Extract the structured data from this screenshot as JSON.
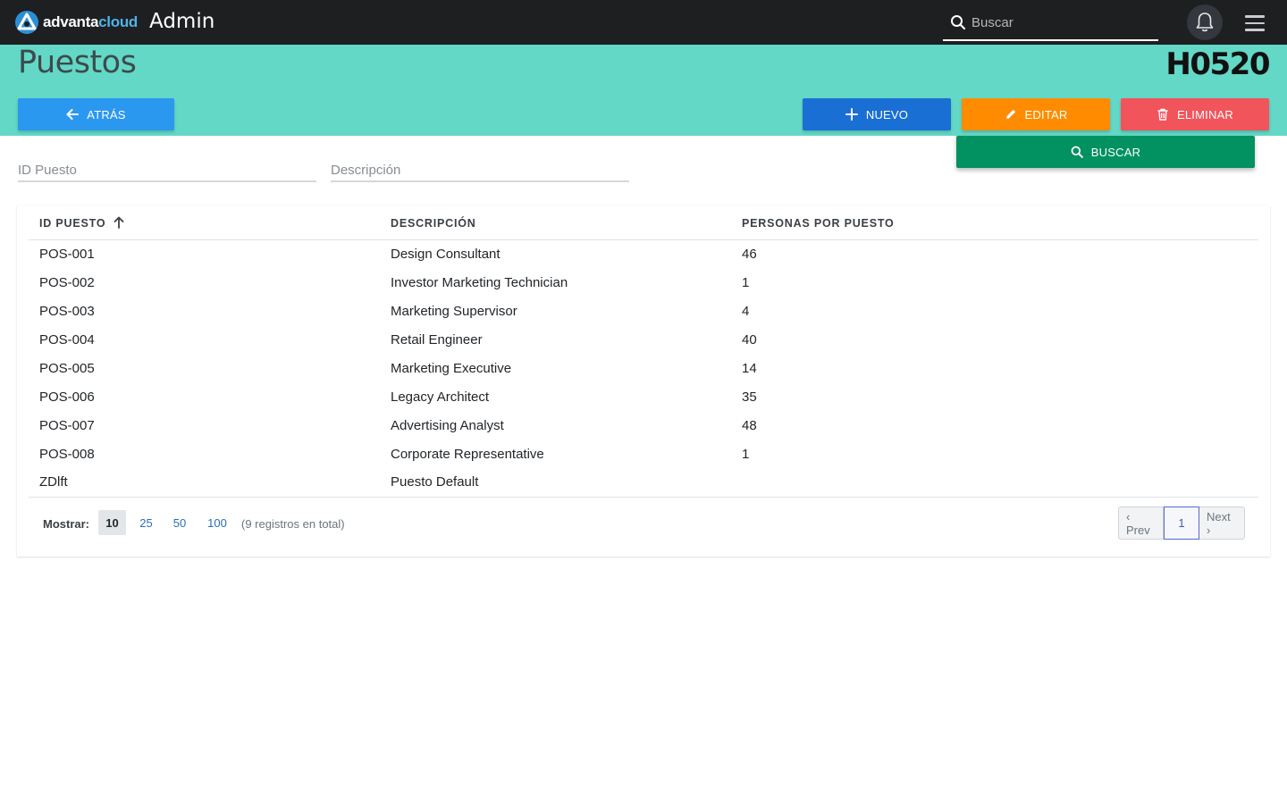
{
  "brand": {
    "part1": "advanta",
    "part2": "cloud",
    "accent": "#4fb3e8"
  },
  "app_title": "Admin",
  "search": {
    "placeholder": "Buscar",
    "value": ""
  },
  "header": {
    "title": "Puestos",
    "code": "H0520",
    "band_color": "#63d8c6"
  },
  "buttons": {
    "back": "ATRÁS",
    "new": "NUEVO",
    "edit": "EDITAR",
    "delete": "ELIMINAR",
    "search": "BUSCAR"
  },
  "filters": {
    "id_placeholder": "ID Puesto",
    "desc_placeholder": "Descripción"
  },
  "table": {
    "columns": [
      "ID PUESTO",
      "DESCRIPCIÓN",
      "PERSONAS POR PUESTO"
    ],
    "sort": {
      "column": "ID PUESTO",
      "direction": "ascending",
      "icon": "arrow-up-icon"
    },
    "rows": [
      {
        "id": "POS-001",
        "desc": "Design Consultant",
        "count": "46"
      },
      {
        "id": "POS-002",
        "desc": "Investor Marketing Technician",
        "count": "1"
      },
      {
        "id": "POS-003",
        "desc": "Marketing Supervisor",
        "count": "4"
      },
      {
        "id": "POS-004",
        "desc": "Retail Engineer",
        "count": "40"
      },
      {
        "id": "POS-005",
        "desc": "Marketing Executive",
        "count": "14"
      },
      {
        "id": "POS-006",
        "desc": "Legacy Architect",
        "count": "35"
      },
      {
        "id": "POS-007",
        "desc": "Advertising Analyst",
        "count": "48"
      },
      {
        "id": "POS-008",
        "desc": "Corporate Representative",
        "count": "1"
      },
      {
        "id": "ZDlft",
        "desc": "Puesto Default",
        "count": ""
      }
    ]
  },
  "footer": {
    "show_label": "Mostrar:",
    "page_sizes": [
      "10",
      "25",
      "50",
      "100"
    ],
    "selected_page_size": "10",
    "total": "(9 registros en total)",
    "prev": "‹ Prev",
    "current_page": "1",
    "next": "Next ›"
  },
  "colors": {
    "back": "#2b98f0",
    "new": "#1a6fd4",
    "edit": "#ff8c00",
    "delete": "#f2545b",
    "search": "#029160"
  }
}
